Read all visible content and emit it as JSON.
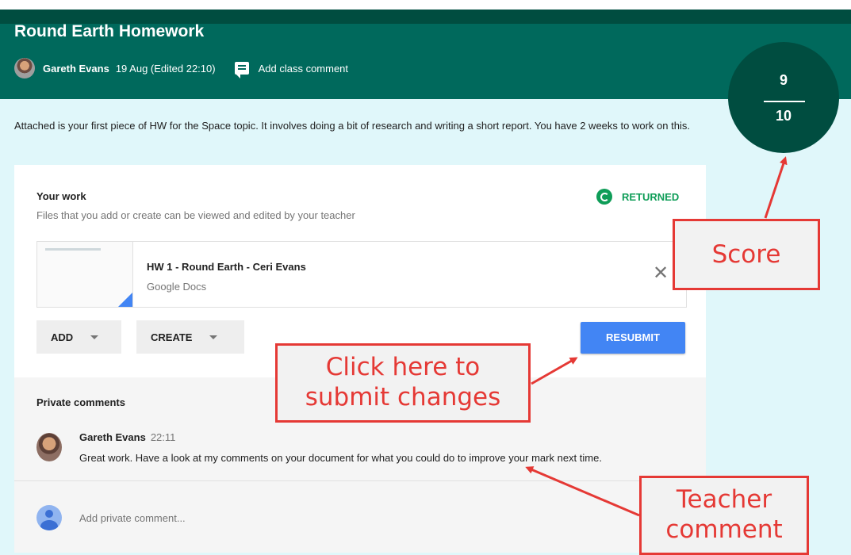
{
  "assignment": {
    "title": "Round Earth Homework",
    "author": "Gareth Evans",
    "date": "19 Aug (Edited 22:10)",
    "add_class_comment": "Add class comment",
    "description": "Attached is your first piece of HW for the Space topic. It involves doing a bit of research and writing a short report. You have 2 weeks to work on this."
  },
  "score": {
    "points": "9",
    "max": "10"
  },
  "your_work": {
    "title": "Your work",
    "subtitle": "Files that you add or create can be viewed and edited by your teacher",
    "status": "RETURNED",
    "status_color": "#0f9d58",
    "file": {
      "name": "HW 1 - Round Earth - Ceri Evans",
      "type": "Google Docs"
    },
    "add_label": "ADD",
    "create_label": "CREATE",
    "resubmit_label": "RESUBMIT"
  },
  "private_comments": {
    "title": "Private comments",
    "comment": {
      "author": "Gareth Evans",
      "time": "22:11",
      "text": "Great work. Have a look at my comments on your document for what you could do to improve your mark next time."
    },
    "placeholder": "Add private comment..."
  },
  "annotations": {
    "score": "Score",
    "submit_line1": "Click here to",
    "submit_line2": "submit changes",
    "teacher_line1": "Teacher",
    "teacher_line2": "comment",
    "color": "#e53935"
  },
  "colors": {
    "header": "#00695c",
    "score_circle": "#004d40",
    "accent_blue": "#4285f4",
    "background": "#e0f7fa"
  }
}
